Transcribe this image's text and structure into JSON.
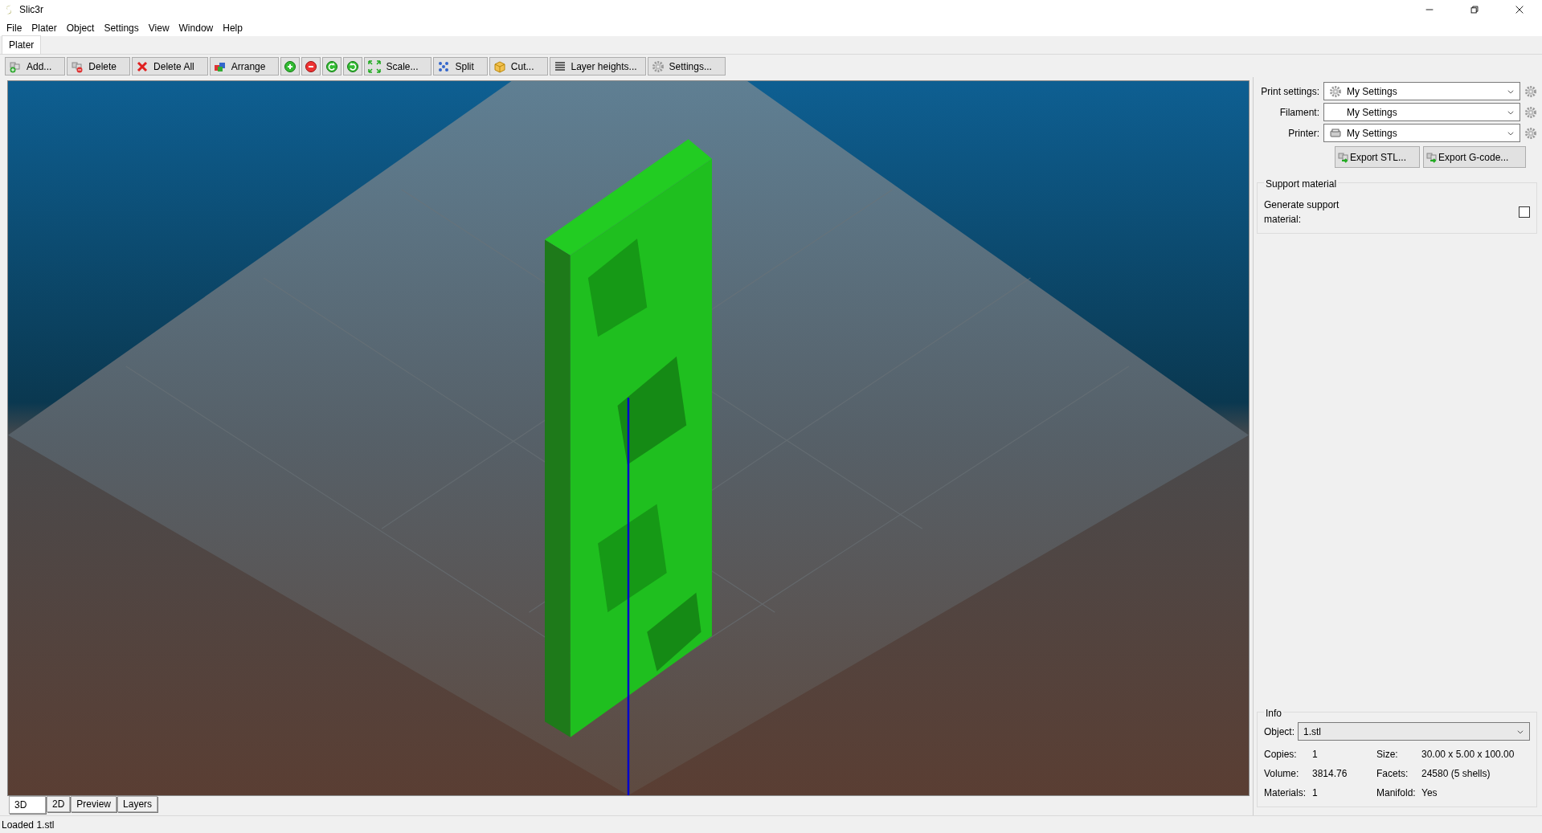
{
  "window": {
    "title": "Slic3r"
  },
  "menu": [
    "File",
    "Plater",
    "Object",
    "Settings",
    "View",
    "Window",
    "Help"
  ],
  "tabs": [
    {
      "label": "Plater",
      "selected": true
    }
  ],
  "toolbar": [
    {
      "kind": "text",
      "label": "Add..."
    },
    {
      "kind": "text",
      "label": "Delete"
    },
    {
      "kind": "text",
      "label": "Delete All"
    },
    {
      "kind": "text",
      "label": "Arrange"
    },
    {
      "kind": "icon"
    },
    {
      "kind": "icon"
    },
    {
      "kind": "icon"
    },
    {
      "kind": "icon"
    },
    {
      "kind": "text",
      "label": "Scale..."
    },
    {
      "kind": "text",
      "label": "Split"
    },
    {
      "kind": "text",
      "label": "Cut..."
    },
    {
      "kind": "text",
      "label": "Layer heights..."
    },
    {
      "kind": "text",
      "label": "Settings..."
    }
  ],
  "presets": [
    {
      "label": "Print settings:",
      "value": "My Settings",
      "kind": "print"
    },
    {
      "label": "Filament:",
      "value": "My Settings",
      "kind": "filament"
    },
    {
      "label": "Printer:",
      "value": "My Settings",
      "kind": "printer"
    }
  ],
  "export_buttons": [
    "Export STL...",
    "Export G-code..."
  ],
  "support": {
    "title": "Support material",
    "label": "Generate support material:",
    "checked": false
  },
  "info": {
    "title": "Info",
    "object_label": "Object:",
    "object": "1.stl",
    "fields": [
      {
        "label": "Copies:",
        "value": "1"
      },
      {
        "label": "Size:",
        "value": "30.00 x 5.00 x 100.00"
      },
      {
        "label": "Volume:",
        "value": "3814.76"
      },
      {
        "label": "Facets:",
        "value": "24580 (5 shells)"
      },
      {
        "label": "Materials:",
        "value": "1"
      },
      {
        "label": "Manifold:",
        "value": "Yes"
      }
    ]
  },
  "view_tabs": [
    {
      "label": "3D",
      "selected": true
    },
    {
      "label": "2D",
      "selected": false
    },
    {
      "label": "Preview",
      "selected": false
    },
    {
      "label": "Layers",
      "selected": false
    }
  ],
  "status_bar": "Loaded 1.stl"
}
